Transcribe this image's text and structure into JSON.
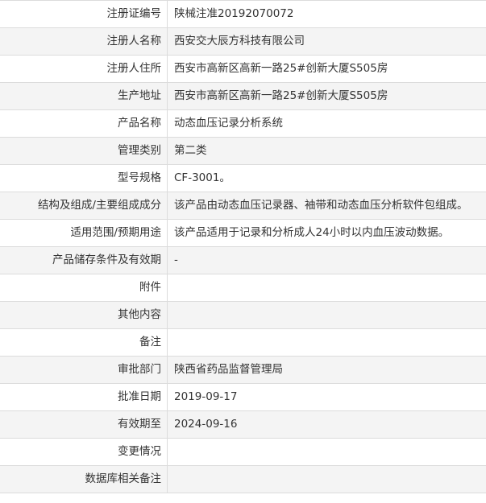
{
  "rows": [
    {
      "label": "注册证编号",
      "value": "陕械注准20192070072"
    },
    {
      "label": "注册人名称",
      "value": "西安交大辰方科技有限公司"
    },
    {
      "label": "注册人住所",
      "value": "西安市高新区高新一路25#创新大厦S505房"
    },
    {
      "label": "生产地址",
      "value": "西安市高新区高新一路25#创新大厦S505房"
    },
    {
      "label": "产品名称",
      "value": "动态血压记录分析系统"
    },
    {
      "label": "管理类别",
      "value": "第二类"
    },
    {
      "label": "型号规格",
      "value": "CF-3001。"
    },
    {
      "label": "结构及组成/主要组成成分",
      "value": "该产品由动态血压记录器、袖带和动态血压分析软件包组成。"
    },
    {
      "label": "适用范围/预期用途",
      "value": "该产品适用于记录和分析成人24小时以内血压波动数据。"
    },
    {
      "label": "产品储存条件及有效期",
      "value": "-"
    },
    {
      "label": "附件",
      "value": ""
    },
    {
      "label": "其他内容",
      "value": ""
    },
    {
      "label": "备注",
      "value": ""
    },
    {
      "label": "审批部门",
      "value": "陕西省药品监督管理局"
    },
    {
      "label": "批准日期",
      "value": "2019-09-17"
    },
    {
      "label": "有效期至",
      "value": "2024-09-16"
    },
    {
      "label": "变更情况",
      "value": ""
    },
    {
      "label": "数据库相关备注",
      "value": ""
    }
  ]
}
